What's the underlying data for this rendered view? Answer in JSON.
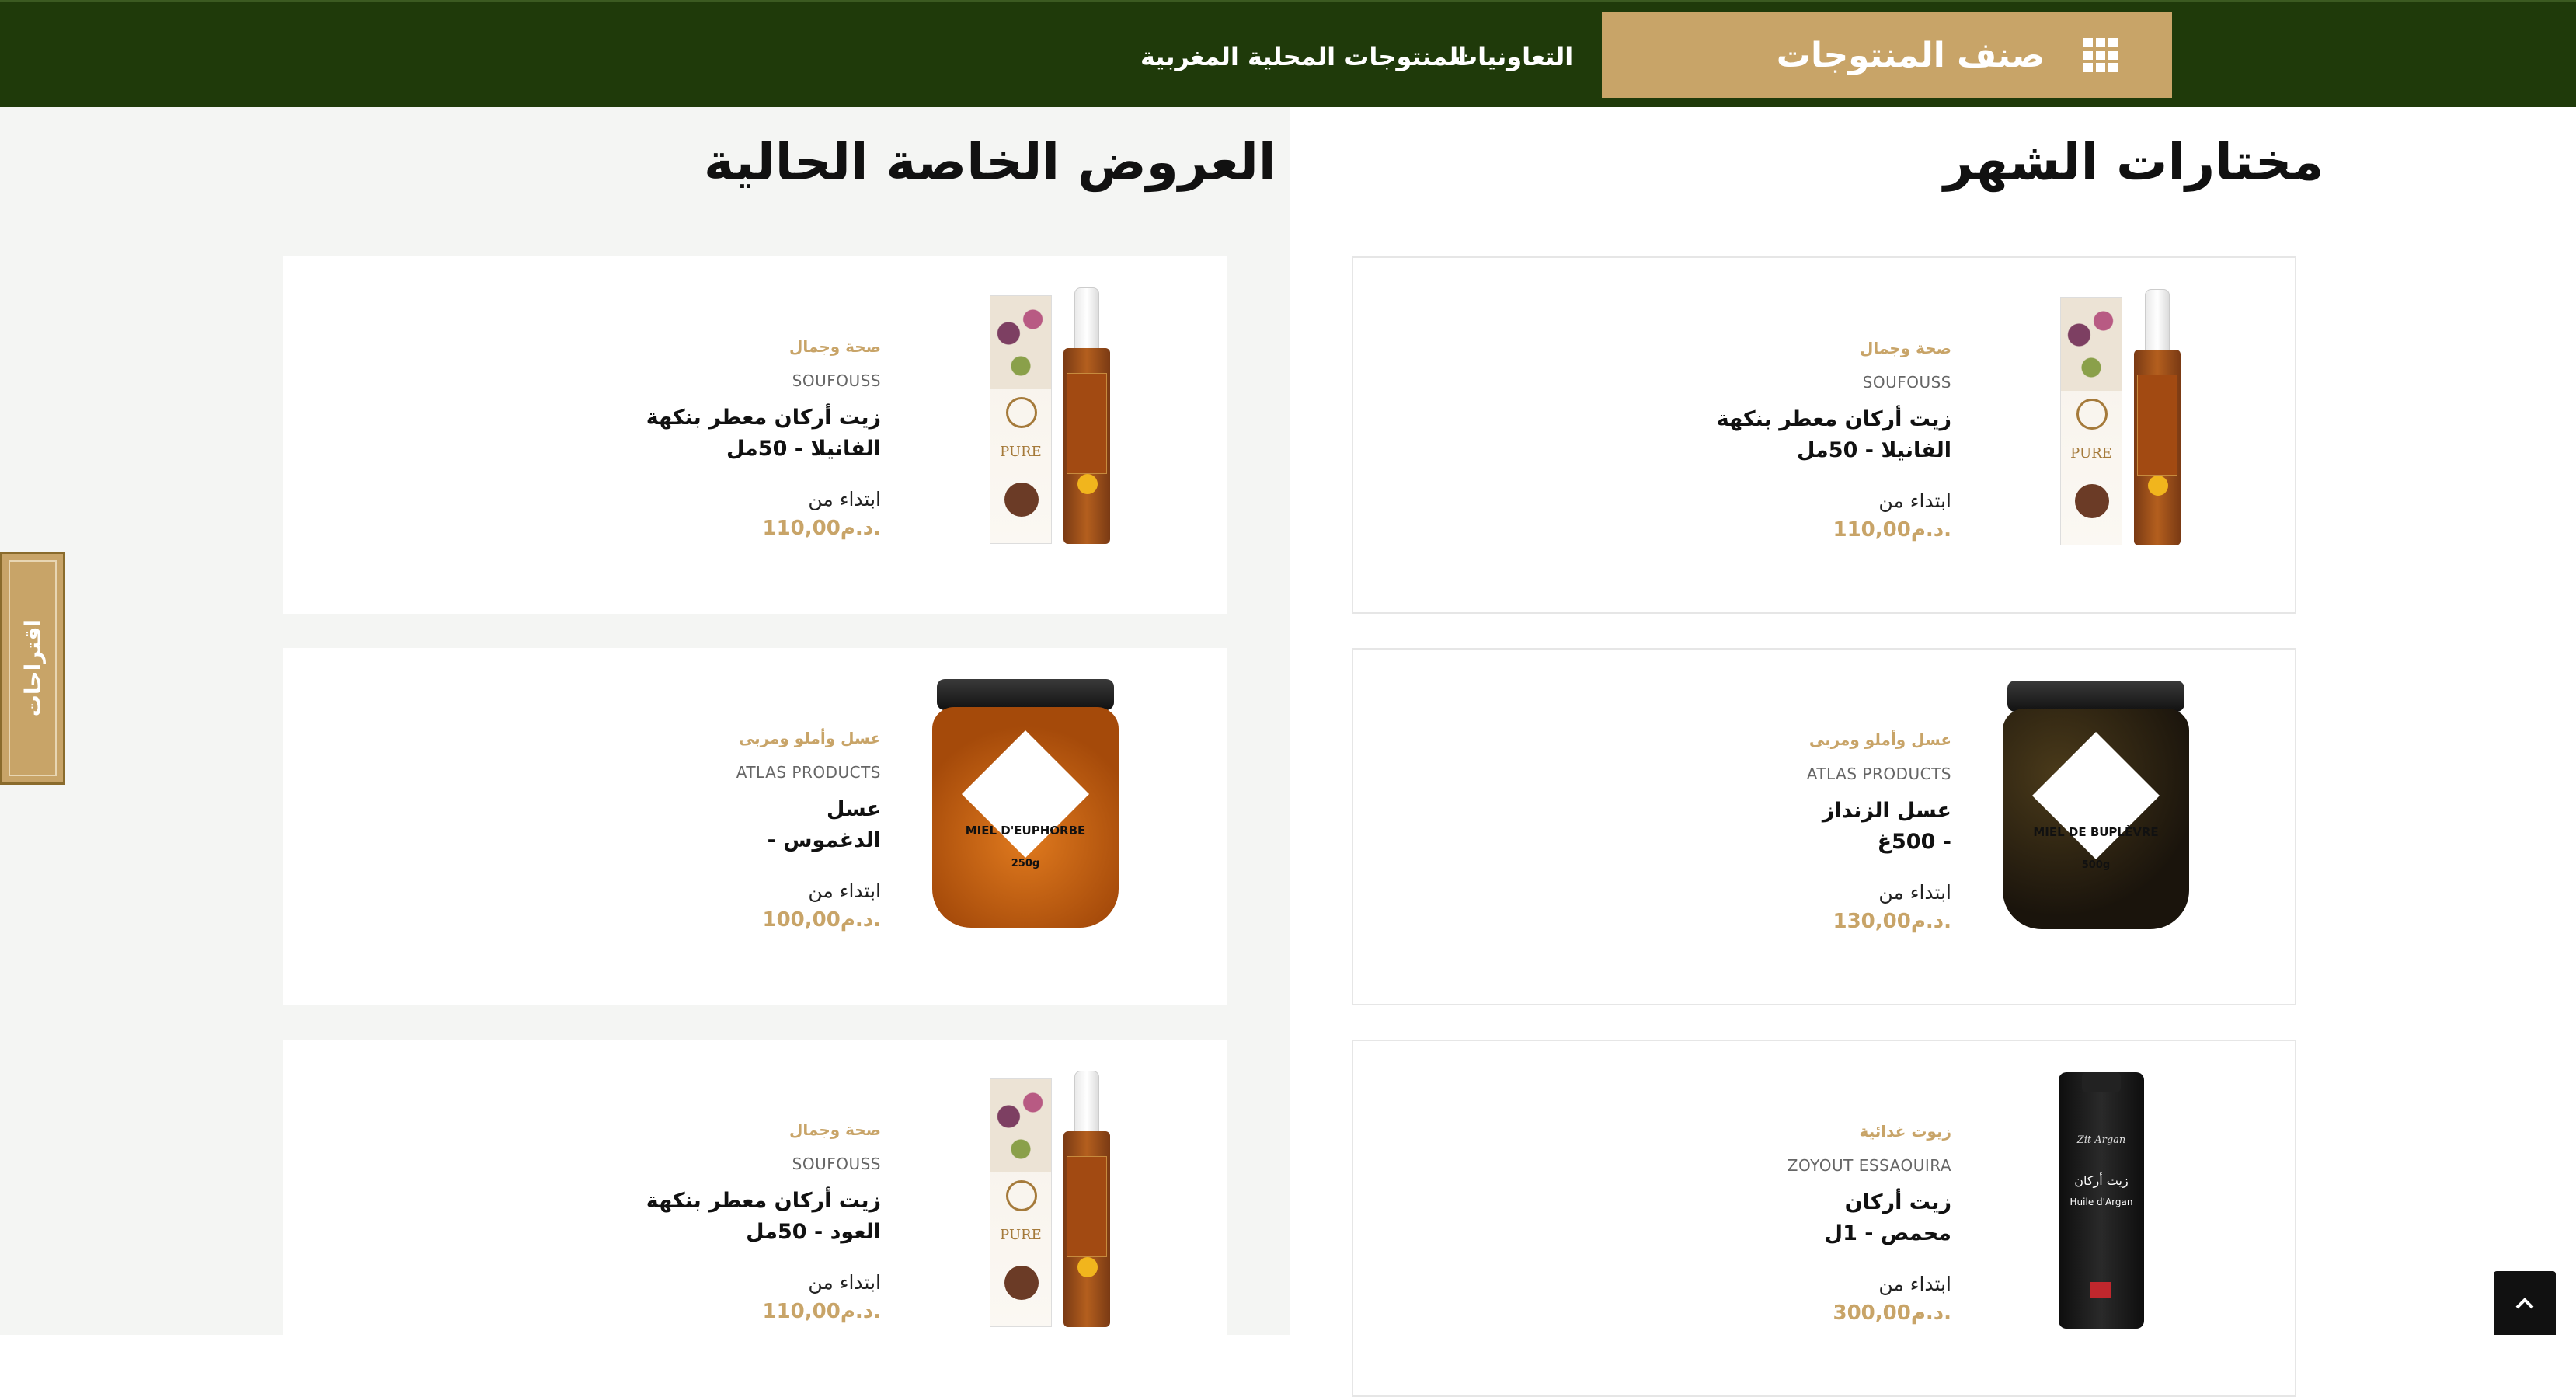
{
  "header": {
    "category_button_label": "صنف المنتوجات",
    "nav": [
      "التعاونيات",
      "المنتوجات المحلية المغربية"
    ]
  },
  "sections": {
    "featured_title": "مختارات الشهر",
    "offers_title": "العروض الخاصة الحالية"
  },
  "featured": [
    {
      "category": "صحة وجمال",
      "brand": "SOUFOUSS",
      "name_line1": "زيت أركان معطر بنكهة",
      "name_line2": "الفانيلا - 50مل",
      "from": "ابتداء من",
      "price": "110,00د.م."
    },
    {
      "category": "عسل وأملو ومربى",
      "brand": "ATLAS PRODUCTS",
      "name_line1": "عسل الزنداز",
      "name_line2": "- 500غ",
      "from": "ابتداء من",
      "price": "130,00د.م."
    },
    {
      "category": "زيوت غدائية",
      "brand": "ZOYOUT ESSAOUIRA",
      "name_line1": "زيت أركان",
      "name_line2": "محمص - 1ل",
      "from": "ابتداء من",
      "price": "300,00د.م."
    }
  ],
  "offers": [
    {
      "category": "صحة وجمال",
      "brand": "SOUFOUSS",
      "name_line1": "زيت أركان معطر بنكهة",
      "name_line2": "الفانيلا - 50مل",
      "from": "ابتداء من",
      "price": "110,00د.م."
    },
    {
      "category": "عسل وأملو ومربى",
      "brand": "ATLAS PRODUCTS",
      "name_line1": "عسل",
      "name_line2": "الدغموس -",
      "from": "ابتداء من",
      "price": "100,00د.م."
    },
    {
      "category": "صحة وجمال",
      "brand": "SOUFOUSS",
      "name_line1": "زيت أركان معطر بنكهة",
      "name_line2": "العود - 50مل",
      "from": "ابتداء من",
      "price": "110,00د.م."
    }
  ],
  "product_labels": {
    "argan_box_word": "PURE",
    "jar1_title": "MIEL DE BUPLÈVRE",
    "jar1_weight": "500g",
    "jar2_title": "MIEL D'EUPHORBE",
    "jar2_weight": "250g",
    "tin_brand": "Zit Argan",
    "tin_ar": "زيت أركان",
    "tin_fr": "Huile d'Argan"
  },
  "side_tab_label": "اقتراحات",
  "scroll_top_icon": "chevron-up-icon",
  "colors": {
    "header_bg": "#1f3a0a",
    "accent": "#c8a468"
  }
}
